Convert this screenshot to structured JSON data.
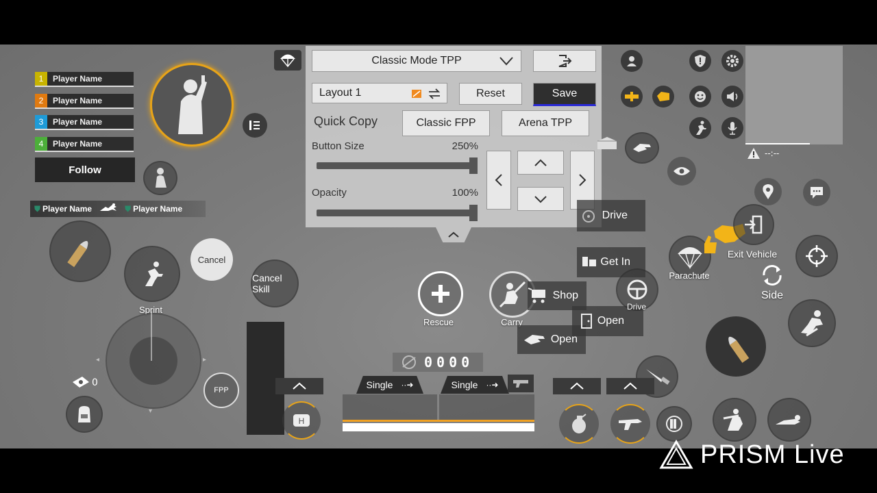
{
  "team": {
    "members": [
      {
        "num": "1",
        "name": "Player Name",
        "color": "#c8b400"
      },
      {
        "num": "2",
        "name": "Player Name",
        "color": "#e07a10"
      },
      {
        "num": "3",
        "name": "Player Name",
        "color": "#1e9bd8"
      },
      {
        "num": "4",
        "name": "Player Name",
        "color": "#4caf3a"
      }
    ],
    "follow_label": "Follow",
    "kill_feed": {
      "killer": "Player Name",
      "victim": "Player Name"
    }
  },
  "panel": {
    "mode_select": "Classic Mode TPP",
    "layout_name": "Layout 1",
    "reset_label": "Reset",
    "save_label": "Save",
    "quick_copy_label": "Quick Copy",
    "copy_fpp_label": "Classic FPP",
    "copy_arena_label": "Arena TPP",
    "button_size_label": "Button Size",
    "button_size_value": "250%",
    "opacity_label": "Opacity",
    "opacity_value": "100%"
  },
  "controls": {
    "cancel": "Cancel",
    "cancel_skill": "Cancel Skill",
    "sprint": "Sprint",
    "fpp": "FPP",
    "ammo_count": "0",
    "rescue": "Rescue",
    "carry": "Carry",
    "shop": "Shop",
    "open_door": "Open",
    "open_hand": "Open",
    "drive_box": "Drive",
    "get_in": "Get In",
    "drive_circle": "Drive",
    "parachute": "Parachute",
    "exit_vehicle": "Exit Vehicle",
    "side": "Side",
    "fire_mode_1": "Single",
    "fire_mode_2": "Single",
    "ammo_digits": "0000",
    "minimap_text": "--:--"
  },
  "watermark": "PRISM Live",
  "colors": {
    "accent_orange": "#f0a020",
    "save_underline": "#2a2ad8",
    "yellow_icon": "#f2b418"
  }
}
